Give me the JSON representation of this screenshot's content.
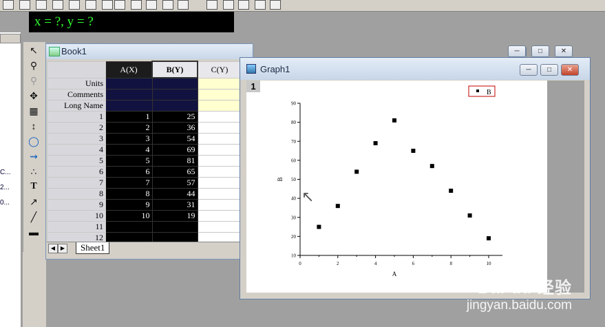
{
  "coord_display": "x = ?, y = ?",
  "book": {
    "title": "Book1",
    "columns": [
      "A(X)",
      "B(Y)",
      "C(Y)"
    ],
    "meta_rows": [
      "Units",
      "Comments",
      "Long Name"
    ],
    "rows": [
      {
        "n": "1",
        "a": "1",
        "b": "25"
      },
      {
        "n": "2",
        "a": "2",
        "b": "36"
      },
      {
        "n": "3",
        "a": "3",
        "b": "54"
      },
      {
        "n": "4",
        "a": "4",
        "b": "69"
      },
      {
        "n": "5",
        "a": "5",
        "b": "81"
      },
      {
        "n": "6",
        "a": "6",
        "b": "65"
      },
      {
        "n": "7",
        "a": "7",
        "b": "57"
      },
      {
        "n": "8",
        "a": "8",
        "b": "44"
      },
      {
        "n": "9",
        "a": "9",
        "b": "31"
      },
      {
        "n": "10",
        "a": "10",
        "b": "19"
      },
      {
        "n": "11",
        "a": "",
        "b": ""
      },
      {
        "n": "12",
        "a": "",
        "b": ""
      }
    ],
    "sheet_tab": "Sheet1"
  },
  "graph": {
    "title": "Graph1",
    "layer": "1",
    "legend": "B"
  },
  "left_list": [
    "C...",
    "2...",
    "0..."
  ],
  "chart_data": {
    "type": "scatter",
    "x": [
      1,
      2,
      3,
      4,
      5,
      6,
      7,
      8,
      9,
      10
    ],
    "series": [
      {
        "name": "B",
        "values": [
          25,
          36,
          54,
          69,
          81,
          65,
          57,
          44,
          31,
          19
        ]
      }
    ],
    "xlabel": "A",
    "ylabel": "B",
    "xlim": [
      0,
      10
    ],
    "ylim": [
      10,
      90
    ],
    "xticks": [
      "0",
      "2",
      "4",
      "6",
      "8",
      "10"
    ],
    "yticks": [
      "10",
      "20",
      "30",
      "40",
      "50",
      "60",
      "70",
      "80",
      "90"
    ],
    "legend_position": "top-right",
    "grid": false
  },
  "watermark": {
    "brand": "Bai du 经验",
    "url": "jingyan.baidu.com"
  }
}
